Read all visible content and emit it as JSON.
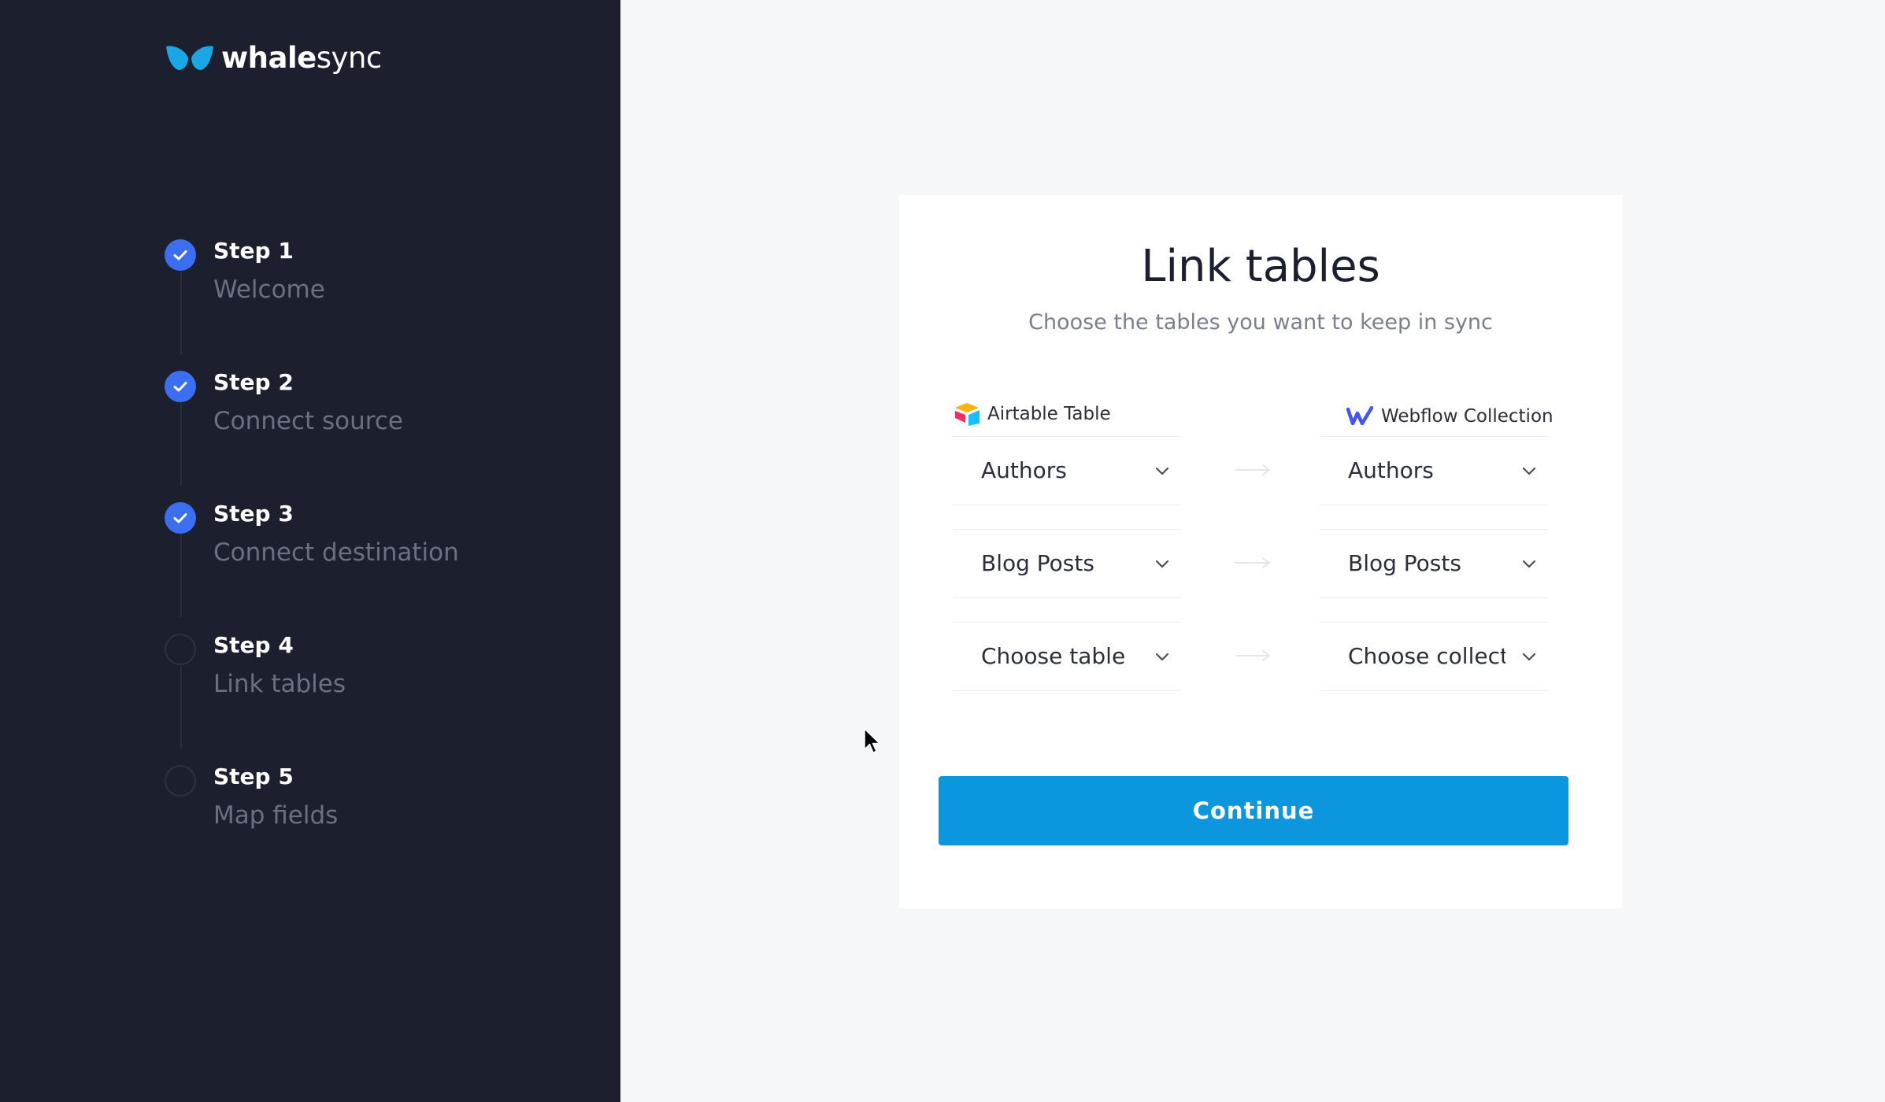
{
  "brand": {
    "name_bold": "whale",
    "name_regular": "sync",
    "accent_color": "#0b96de"
  },
  "steps": [
    {
      "title": "Step 1",
      "subtitle": "Welcome",
      "status": "done"
    },
    {
      "title": "Step 2",
      "subtitle": "Connect source",
      "status": "done"
    },
    {
      "title": "Step 3",
      "subtitle": "Connect destination",
      "status": "done"
    },
    {
      "title": "Step 4",
      "subtitle": "Link tables",
      "status": "todo"
    },
    {
      "title": "Step 5",
      "subtitle": "Map fields",
      "status": "todo"
    }
  ],
  "card": {
    "title": "Link tables",
    "subtitle": "Choose the tables you want to keep in sync",
    "source_label": "Airtable Table",
    "destination_label": "Webflow Collection",
    "rows": [
      {
        "source": "Authors",
        "destination": "Authors"
      },
      {
        "source": "Blog Posts",
        "destination": "Blog Posts"
      },
      {
        "source": "Choose table",
        "destination": "Choose collection"
      }
    ],
    "continue_label": "Continue"
  },
  "icons": {
    "logo": "whale-tail-icon",
    "check": "check-icon",
    "airtable": "airtable-icon",
    "webflow": "webflow-icon",
    "chevron": "chevron-down-icon",
    "arrow": "arrow-right-icon",
    "cursor": "mouse-cursor-icon"
  }
}
